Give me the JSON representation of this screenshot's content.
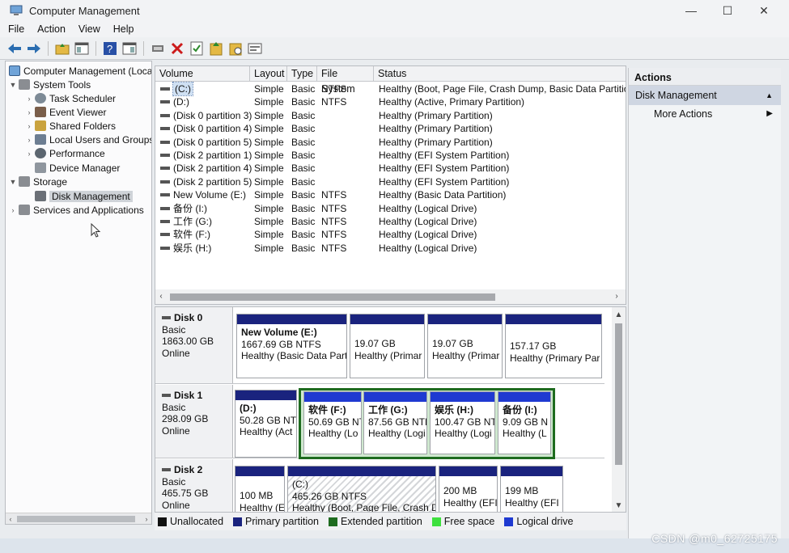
{
  "window": {
    "title": "Computer Management",
    "controls": [
      "—",
      "☐",
      "✕"
    ]
  },
  "menu": [
    "File",
    "Action",
    "View",
    "Help"
  ],
  "toolbar": {
    "icons": [
      "back-arrow-icon",
      "forward-arrow-icon",
      "up-folder-icon",
      "show-hide-tree-icon",
      "help-icon",
      "show-hide-action-pane-icon",
      "connect-icon",
      "delete-icon",
      "properties-icon",
      "open-icon",
      "rescan-icon",
      "export-icon"
    ]
  },
  "tree": {
    "root": "Computer Management (Local",
    "system_tools": "System Tools",
    "task_scheduler": "Task Scheduler",
    "event_viewer": "Event Viewer",
    "shared_folders": "Shared Folders",
    "local_users": "Local Users and Groups",
    "performance": "Performance",
    "device_manager": "Device Manager",
    "storage": "Storage",
    "disk_management": "Disk Management",
    "services": "Services and Applications"
  },
  "volume_list": {
    "columns": [
      "Volume",
      "Layout",
      "Type",
      "File System",
      "Status"
    ],
    "rows": [
      {
        "volume": "(C:)",
        "layout": "Simple",
        "type": "Basic",
        "fs": "NTFS",
        "status": "Healthy (Boot, Page File, Crash Dump, Basic Data Partition)"
      },
      {
        "volume": "(D:)",
        "layout": "Simple",
        "type": "Basic",
        "fs": "NTFS",
        "status": "Healthy (Active, Primary Partition)"
      },
      {
        "volume": "(Disk 0 partition 3)",
        "layout": "Simple",
        "type": "Basic",
        "fs": "",
        "status": "Healthy (Primary Partition)"
      },
      {
        "volume": "(Disk 0 partition 4)",
        "layout": "Simple",
        "type": "Basic",
        "fs": "",
        "status": "Healthy (Primary Partition)"
      },
      {
        "volume": "(Disk 0 partition 5)",
        "layout": "Simple",
        "type": "Basic",
        "fs": "",
        "status": "Healthy (Primary Partition)"
      },
      {
        "volume": "(Disk 2 partition 1)",
        "layout": "Simple",
        "type": "Basic",
        "fs": "",
        "status": "Healthy (EFI System Partition)"
      },
      {
        "volume": "(Disk 2 partition 4)",
        "layout": "Simple",
        "type": "Basic",
        "fs": "",
        "status": "Healthy (EFI System Partition)"
      },
      {
        "volume": "(Disk 2 partition 5)",
        "layout": "Simple",
        "type": "Basic",
        "fs": "",
        "status": "Healthy (EFI System Partition)"
      },
      {
        "volume": "New Volume (E:)",
        "layout": "Simple",
        "type": "Basic",
        "fs": "NTFS",
        "status": "Healthy (Basic Data Partition)"
      },
      {
        "volume": "备份 (I:)",
        "layout": "Simple",
        "type": "Basic",
        "fs": "NTFS",
        "status": "Healthy (Logical Drive)"
      },
      {
        "volume": "工作 (G:)",
        "layout": "Simple",
        "type": "Basic",
        "fs": "NTFS",
        "status": "Healthy (Logical Drive)"
      },
      {
        "volume": "软件 (F:)",
        "layout": "Simple",
        "type": "Basic",
        "fs": "NTFS",
        "status": "Healthy (Logical Drive)"
      },
      {
        "volume": "娱乐 (H:)",
        "layout": "Simple",
        "type": "Basic",
        "fs": "NTFS",
        "status": "Healthy (Logical Drive)"
      }
    ]
  },
  "disks": [
    {
      "name": "Disk 0",
      "type": "Basic",
      "size": "1863.00 GB",
      "state": "Online",
      "partitions": [
        {
          "title": "New Volume  (E:)",
          "line2": "1667.69 GB NTFS",
          "line3": "Healthy (Basic Data Parti",
          "kind": "primary"
        },
        {
          "title": "",
          "line2": "19.07 GB",
          "line3": "Healthy (Primar",
          "kind": "primary"
        },
        {
          "title": "",
          "line2": "19.07 GB",
          "line3": "Healthy (Primar",
          "kind": "primary"
        },
        {
          "title": "",
          "line2": "157.17 GB",
          "line3": "Healthy (Primary Par",
          "kind": "primary"
        }
      ]
    },
    {
      "name": "Disk 1",
      "type": "Basic",
      "size": "298.09 GB",
      "state": "Online",
      "partitions": [
        {
          "title": "(D:)",
          "line2": "50.28 GB NTI",
          "line3": "Healthy (Act",
          "kind": "primary"
        },
        {
          "title": "软件  (F:)",
          "line2": "50.69 GB NT",
          "line3": "Healthy (Lo",
          "kind": "logical"
        },
        {
          "title": "工作  (G:)",
          "line2": "87.56 GB NTF:",
          "line3": "Healthy (Logi",
          "kind": "logical"
        },
        {
          "title": "娱乐  (H:)",
          "line2": "100.47 GB NTI",
          "line3": "Healthy (Logi",
          "kind": "logical"
        },
        {
          "title": "备份  (I:)",
          "line2": "9.09 GB N",
          "line3": "Healthy (L",
          "kind": "logical"
        }
      ]
    },
    {
      "name": "Disk 2",
      "type": "Basic",
      "size": "465.75 GB",
      "state": "Online",
      "partitions": [
        {
          "title": "",
          "line2": "100 MB",
          "line3": "Healthy (E",
          "kind": "primary"
        },
        {
          "title": "(C:)",
          "line2": "465.26 GB NTFS",
          "line3": "Healthy (Boot, Page File, Crash Du",
          "kind": "primary"
        },
        {
          "title": "",
          "line2": "200 MB",
          "line3": "Healthy (EFI",
          "kind": "primary"
        },
        {
          "title": "",
          "line2": "199 MB",
          "line3": "Healthy (EFI",
          "kind": "primary"
        }
      ]
    }
  ],
  "legend": [
    {
      "label": "Unallocated",
      "color": "#111111"
    },
    {
      "label": "Primary partition",
      "color": "#1a237e"
    },
    {
      "label": "Extended partition",
      "color": "#1e6b1f"
    },
    {
      "label": "Free space",
      "color": "#3ee03e"
    },
    {
      "label": "Logical drive",
      "color": "#1f3ad1"
    }
  ],
  "actions": {
    "header": "Actions",
    "section": "Disk Management",
    "more": "More Actions"
  },
  "watermark": "CSDN @m0_62725175"
}
